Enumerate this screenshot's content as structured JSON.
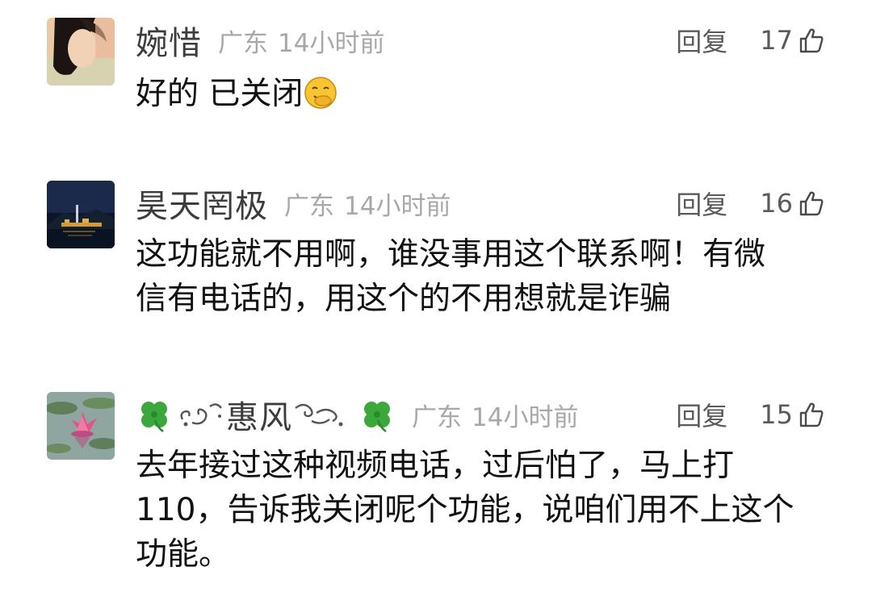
{
  "comments": [
    {
      "username": "婉惜",
      "location": "广东",
      "time": "14小时前",
      "reply_label": "回复",
      "likes": "17",
      "text": "好的  已关闭",
      "emoji": "smiling-face-with-hand-emoji"
    },
    {
      "username": "昊天罔极",
      "location": "广东",
      "time": "14小时前",
      "reply_label": "回复",
      "likes": "16",
      "text_lines": [
        "这功能就不用啊，谁没事用这个联系啊！有微",
        "信有电话的，用这个的不用想就是诈骗"
      ]
    },
    {
      "username": "惠风",
      "location": "广东",
      "time": "14小时前",
      "reply_label": "回复",
      "likes": "15",
      "text_lines": [
        "去年接过这种视频电话，过后怕了，马上打",
        "110，告诉我关闭呢个功能，说咱们用不上这个",
        "功能。"
      ]
    }
  ],
  "icons": {
    "like": "thumbs-up-outline-icon",
    "clover": "four-leaf-clover-icon"
  },
  "colors": {
    "username": "#3c3c3c",
    "meta": "#a8a8a8",
    "body": "#111111",
    "clover": "#3aa83a"
  }
}
